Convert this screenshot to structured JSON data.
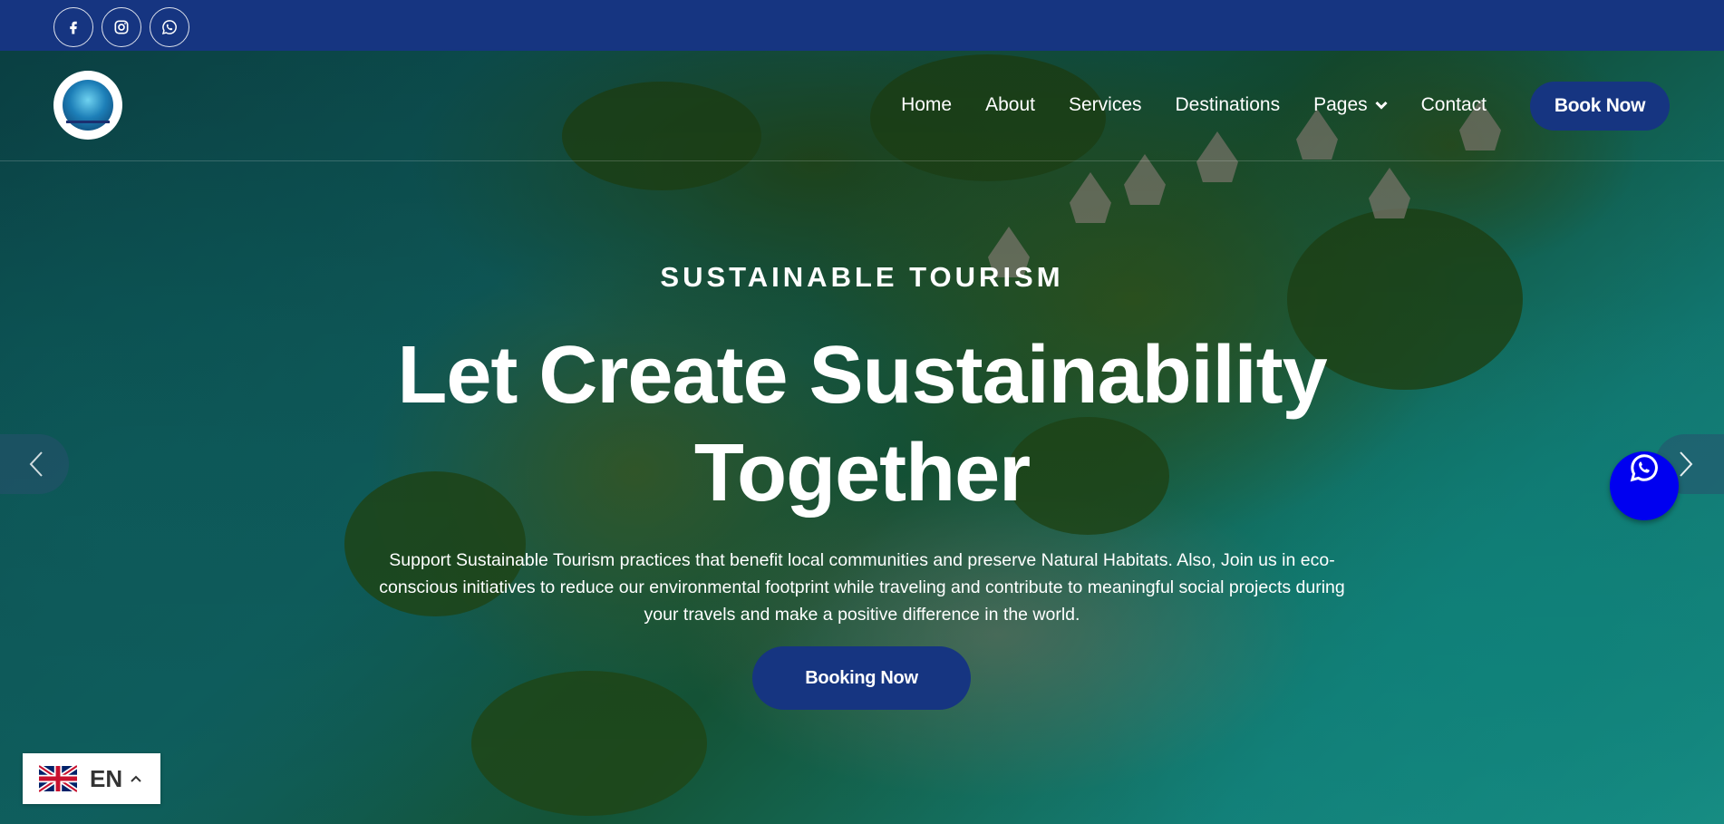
{
  "social": {
    "items": [
      {
        "icon": "facebook-icon"
      },
      {
        "icon": "instagram-icon"
      },
      {
        "icon": "whatsapp-icon"
      }
    ]
  },
  "nav": {
    "items": [
      {
        "label": "Home"
      },
      {
        "label": "About"
      },
      {
        "label": "Services"
      },
      {
        "label": "Destinations"
      },
      {
        "label": "Pages",
        "has_dropdown": true
      },
      {
        "label": "Contact"
      }
    ],
    "book_button": "Book Now"
  },
  "hero": {
    "subtitle": "SUSTAINABLE TOURISM",
    "title_line1": "Let Create Sustainability",
    "title_line2": "Together",
    "description": "Support Sustainable Tourism practices that benefit local communities and preserve Natural Habitats. Also, Join us in eco-conscious initiatives to reduce our environmental footprint while traveling and contribute to meaningful social projects during your travels and make a positive difference in the world.",
    "cta": "Booking Now"
  },
  "language": {
    "code": "EN",
    "flag": "uk-flag-icon"
  },
  "colors": {
    "brand": "#163581",
    "whatsapp_float": "#0000f0"
  }
}
